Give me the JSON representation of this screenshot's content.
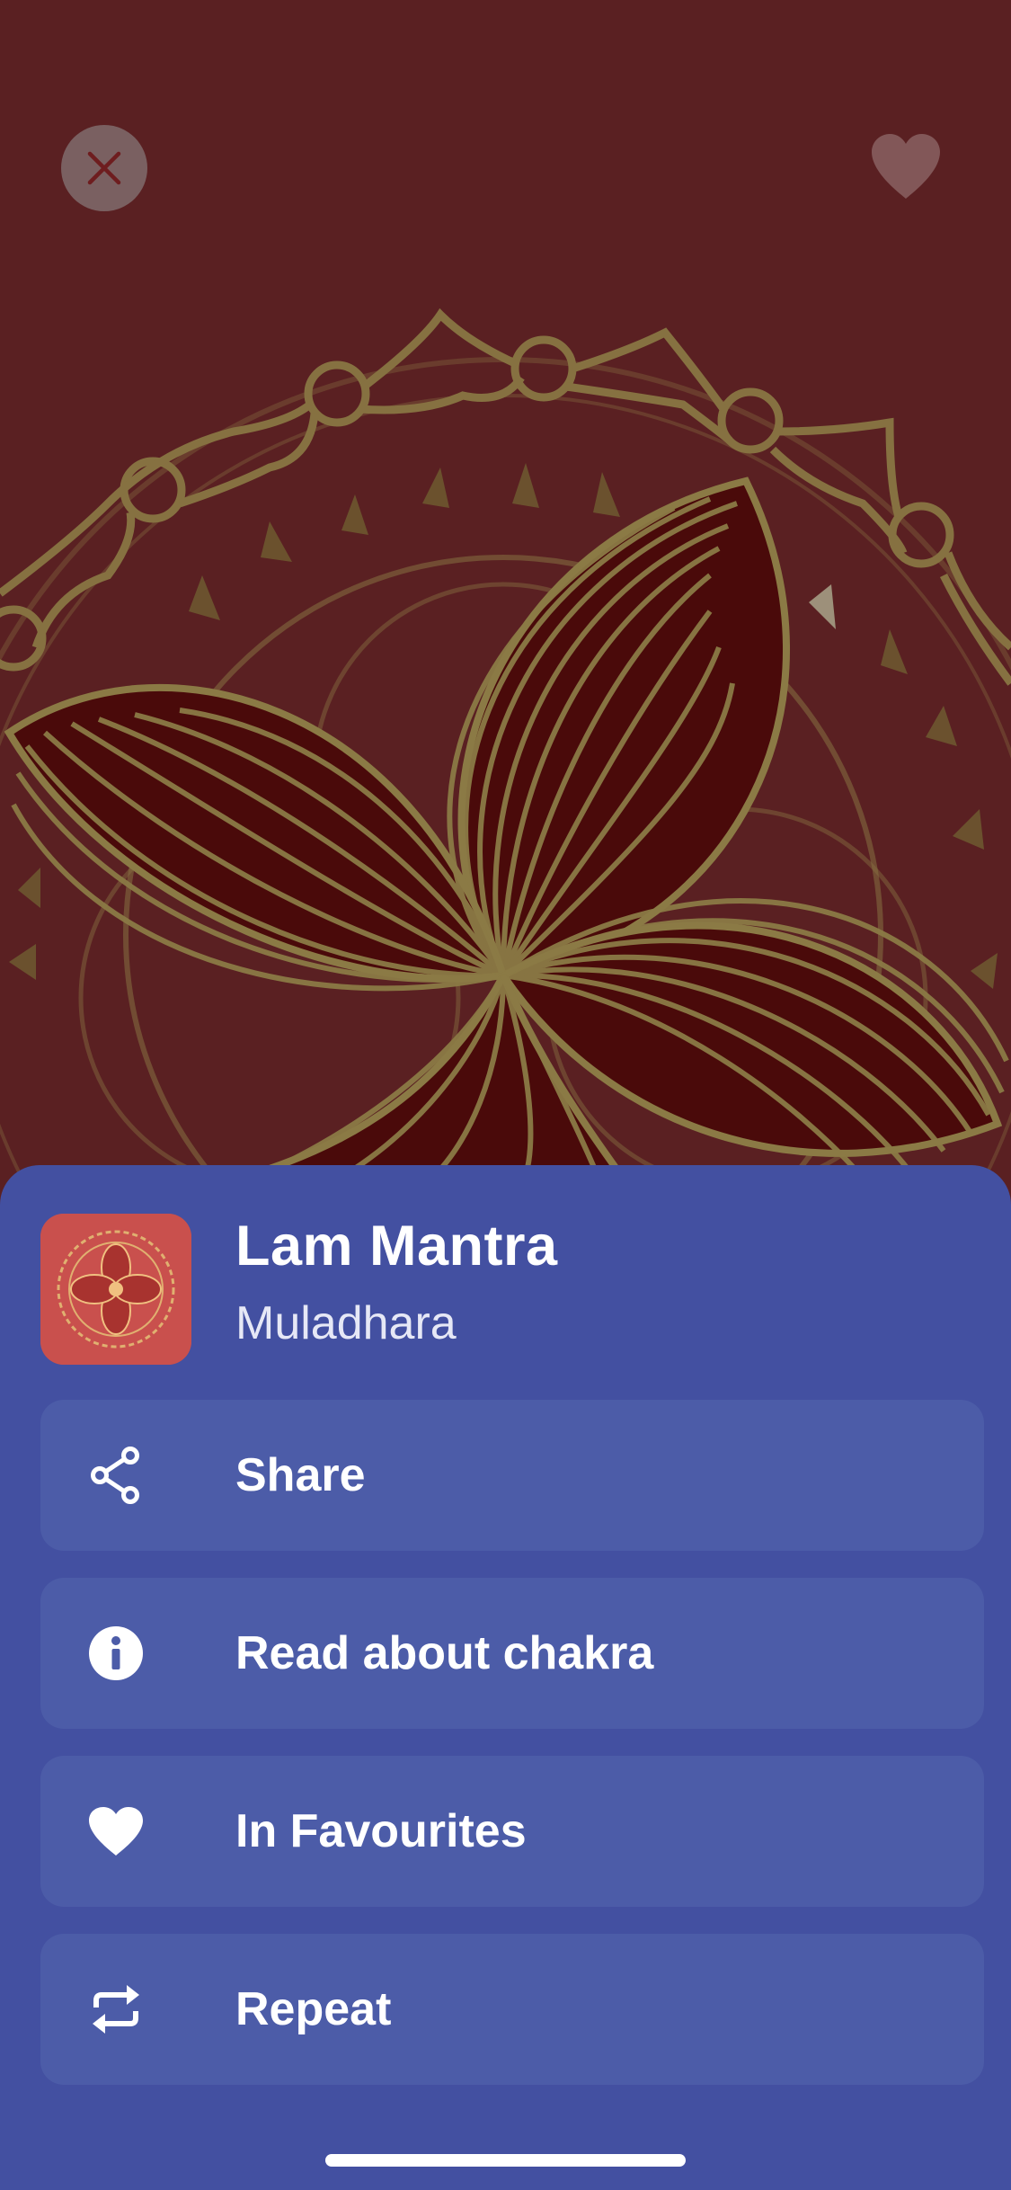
{
  "track": {
    "title": "Lam Mantra",
    "subtitle": "Muladhara"
  },
  "actions": [
    {
      "label": "Share",
      "icon": "share-icon"
    },
    {
      "label": "Read about chakra",
      "icon": "info-icon"
    },
    {
      "label": "In Favourites",
      "icon": "heart-icon"
    },
    {
      "label": "Repeat",
      "icon": "repeat-icon"
    }
  ],
  "top_bar": {
    "close_icon": "close-icon",
    "favourite_icon": "heart-icon"
  },
  "colors": {
    "background": "#5a2022",
    "sheet": "#4350a1",
    "row": "#4c5ca8",
    "gold": "#8b7a45",
    "thumb": "#c9504d"
  }
}
